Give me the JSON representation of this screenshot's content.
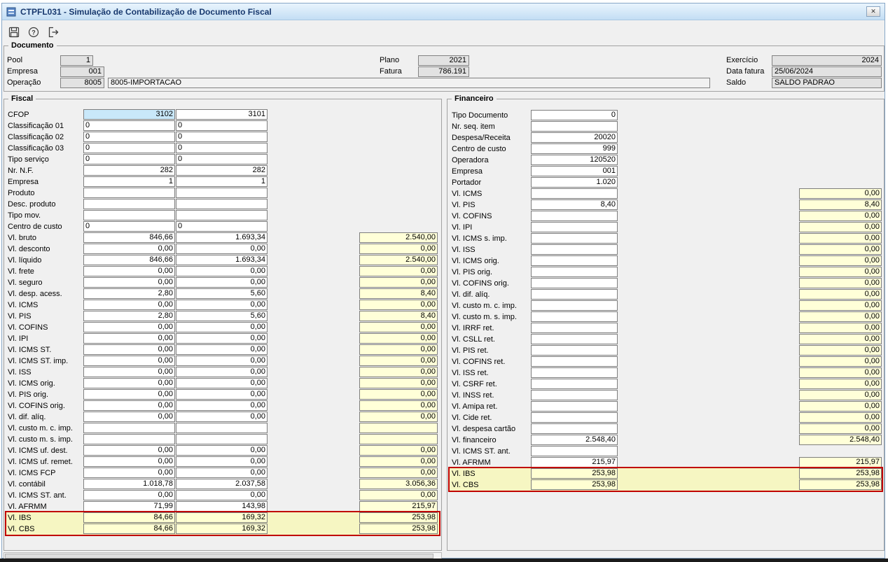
{
  "window": {
    "title": "CTPFL031 - Simulação de Contabilização de Documento Fiscal",
    "close_glyph": "✕"
  },
  "toolbar": {
    "buttons": [
      {
        "name": "save"
      },
      {
        "name": "help"
      },
      {
        "name": "exit"
      }
    ]
  },
  "documento": {
    "title": "Documento",
    "pool": {
      "label": "Pool",
      "value": "1"
    },
    "empresa": {
      "label": "Empresa",
      "value": "001"
    },
    "operacao": {
      "label": "Operação",
      "value": "8005",
      "descricao": "8005-IMPORTACAO"
    },
    "plano": {
      "label": "Plano",
      "value": "2021"
    },
    "fatura": {
      "label": "Fatura",
      "value": "786.191"
    },
    "exercicio": {
      "label": "Exercício",
      "value": "2024"
    },
    "data_fatura": {
      "label": "Data fatura",
      "value": "25/06/2024"
    },
    "saldo": {
      "label": "Saldo",
      "value": "SALDO PADRAO"
    }
  },
  "fiscal": {
    "title": "Fiscal",
    "rows": [
      {
        "label": "CFOP",
        "c1": "3102",
        "c2": "3101",
        "total": null,
        "focus": "c1"
      },
      {
        "label": "Classificação 01",
        "c1": "0",
        "c2": "0",
        "total": null,
        "align": "left"
      },
      {
        "label": "Classificação 02",
        "c1": "0",
        "c2": "0",
        "total": null,
        "align": "left"
      },
      {
        "label": "Classificação 03",
        "c1": "0",
        "c2": "0",
        "total": null,
        "align": "left"
      },
      {
        "label": "Tipo serviço",
        "c1": "0",
        "c2": "0",
        "total": null,
        "align": "left"
      },
      {
        "label": "Nr. N.F.",
        "c1": "282",
        "c2": "282",
        "total": null
      },
      {
        "label": "Empresa",
        "c1": "1",
        "c2": "1",
        "total": null
      },
      {
        "label": "Produto",
        "c1": "",
        "c2": "",
        "total": null
      },
      {
        "label": "Desc. produto",
        "c1": "",
        "c2": "",
        "total": null
      },
      {
        "label": "Tipo mov.",
        "c1": "",
        "c2": "",
        "total": null
      },
      {
        "label": "Centro de custo",
        "c1": "0",
        "c2": "0",
        "total": null,
        "align": "left"
      },
      {
        "label": "Vl. bruto",
        "c1": "846,66",
        "c2": "1.693,34",
        "total": "2.540,00"
      },
      {
        "label": "Vl. desconto",
        "c1": "0,00",
        "c2": "0,00",
        "total": "0,00"
      },
      {
        "label": "Vl. líquido",
        "c1": "846,66",
        "c2": "1.693,34",
        "total": "2.540,00"
      },
      {
        "label": "Vl. frete",
        "c1": "0,00",
        "c2": "0,00",
        "total": "0,00"
      },
      {
        "label": "Vl. seguro",
        "c1": "0,00",
        "c2": "0,00",
        "total": "0,00"
      },
      {
        "label": "Vl. desp. acess.",
        "c1": "2,80",
        "c2": "5,60",
        "total": "8,40"
      },
      {
        "label": "Vl. ICMS",
        "c1": "0,00",
        "c2": "0,00",
        "total": "0,00"
      },
      {
        "label": "Vl. PIS",
        "c1": "2,80",
        "c2": "5,60",
        "total": "8,40"
      },
      {
        "label": "Vl. COFINS",
        "c1": "0,00",
        "c2": "0,00",
        "total": "0,00"
      },
      {
        "label": "Vl. IPI",
        "c1": "0,00",
        "c2": "0,00",
        "total": "0,00"
      },
      {
        "label": "Vl. ICMS ST.",
        "c1": "0,00",
        "c2": "0,00",
        "total": "0,00"
      },
      {
        "label": "Vl. ICMS ST. imp.",
        "c1": "0,00",
        "c2": "0,00",
        "total": "0,00"
      },
      {
        "label": "Vl. ISS",
        "c1": "0,00",
        "c2": "0,00",
        "total": "0,00"
      },
      {
        "label": "Vl. ICMS orig.",
        "c1": "0,00",
        "c2": "0,00",
        "total": "0,00"
      },
      {
        "label": "Vl. PIS orig.",
        "c1": "0,00",
        "c2": "0,00",
        "total": "0,00"
      },
      {
        "label": "Vl. COFINS orig.",
        "c1": "0,00",
        "c2": "0,00",
        "total": "0,00"
      },
      {
        "label": "Vl. dif. alíq.",
        "c1": "0,00",
        "c2": "0,00",
        "total": "0,00"
      },
      {
        "label": "Vl. custo m. c. imp.",
        "c1": "",
        "c2": "",
        "total": ""
      },
      {
        "label": "Vl. custo m. s. imp.",
        "c1": "",
        "c2": "",
        "total": ""
      },
      {
        "label": "Vl. ICMS uf. dest.",
        "c1": "0,00",
        "c2": "0,00",
        "total": "0,00"
      },
      {
        "label": "Vl. ICMS uf. remet.",
        "c1": "0,00",
        "c2": "0,00",
        "total": "0,00"
      },
      {
        "label": "Vl. ICMS FCP",
        "c1": "0,00",
        "c2": "0,00",
        "total": "0,00"
      },
      {
        "label": "Vl. contábil",
        "c1": "1.018,78",
        "c2": "2.037,58",
        "total": "3.056,36"
      },
      {
        "label": "Vl. ICMS ST. ant.",
        "c1": "0,00",
        "c2": "0,00",
        "total": "0,00"
      },
      {
        "label": "Vl. AFRMM",
        "c1": "71,99",
        "c2": "143,98",
        "total": "215,97"
      },
      {
        "label": "Vl. IBS",
        "c1": "84,66",
        "c2": "169,32",
        "total": "253,98",
        "highlight": true
      },
      {
        "label": "Vl. CBS",
        "c1": "84,66",
        "c2": "169,32",
        "total": "253,98",
        "highlight": true
      }
    ]
  },
  "financeiro": {
    "title": "Financeiro",
    "rows": [
      {
        "label": "Tipo Documento",
        "value": "0",
        "total": null
      },
      {
        "label": "Nr. seq. item",
        "value": "",
        "total": null
      },
      {
        "label": "Despesa/Receita",
        "value": "20020",
        "total": null
      },
      {
        "label": "Centro de custo",
        "value": "999",
        "total": null
      },
      {
        "label": "Operadora",
        "value": "120520",
        "total": null
      },
      {
        "label": "Empresa",
        "value": "001",
        "total": null
      },
      {
        "label": "Portador",
        "value": "1.020",
        "total": null
      },
      {
        "label": "Vl. ICMS",
        "value": "",
        "total": "0,00"
      },
      {
        "label": "Vl. PIS",
        "value": "8,40",
        "total": "8,40"
      },
      {
        "label": "Vl. COFINS",
        "value": "",
        "total": "0,00"
      },
      {
        "label": "Vl. IPI",
        "value": "",
        "total": "0,00"
      },
      {
        "label": "Vl. ICMS s. imp.",
        "value": "",
        "total": "0,00"
      },
      {
        "label": "Vl. ISS",
        "value": "",
        "total": "0,00"
      },
      {
        "label": "Vl. ICMS orig.",
        "value": "",
        "total": "0,00"
      },
      {
        "label": "Vl. PIS orig.",
        "value": "",
        "total": "0,00"
      },
      {
        "label": "Vl. COFINS orig.",
        "value": "",
        "total": "0,00"
      },
      {
        "label": "Vl. dif. alíq.",
        "value": "",
        "total": "0,00"
      },
      {
        "label": "Vl. custo m. c. imp.",
        "value": "",
        "total": "0,00"
      },
      {
        "label": "Vl. custo m. s. imp.",
        "value": "",
        "total": "0,00"
      },
      {
        "label": "Vl. IRRF ret.",
        "value": "",
        "total": "0,00"
      },
      {
        "label": "Vl. CSLL ret.",
        "value": "",
        "total": "0,00"
      },
      {
        "label": "Vl. PIS ret.",
        "value": "",
        "total": "0,00"
      },
      {
        "label": "Vl. COFINS ret.",
        "value": "",
        "total": "0,00"
      },
      {
        "label": "Vl. ISS ret.",
        "value": "",
        "total": "0,00"
      },
      {
        "label": "Vl. CSRF ret.",
        "value": "",
        "total": "0,00"
      },
      {
        "label": "Vl. INSS ret.",
        "value": "",
        "total": "0,00"
      },
      {
        "label": "Vl. Amipa ret.",
        "value": "",
        "total": "0,00"
      },
      {
        "label": "Vl. Cide ret.",
        "value": "",
        "total": "0,00"
      },
      {
        "label": "Vl. despesa cartão",
        "value": "",
        "total": "0,00"
      },
      {
        "label": "Vl. financeiro",
        "value": "2.548,40",
        "total": "2.548,40"
      },
      {
        "label": "Vl. ICMS ST. ant.",
        "value": "",
        "total": null
      },
      {
        "label": "Vl. AFRMM",
        "value": "215,97",
        "total": "215,97"
      },
      {
        "label": "Vl. IBS",
        "value": "253,98",
        "total": "253,98",
        "highlight": true
      },
      {
        "label": "Vl. CBS",
        "value": "253,98",
        "total": "253,98",
        "highlight": true
      }
    ]
  },
  "colors": {
    "titlebar_top": "#e9f4fd",
    "titlebar_bottom": "#c3def4",
    "title_text": "#17386e",
    "dialog_bg": "#f0f0f0",
    "field_border": "#7e7e7e",
    "disabled_field_bg": "#e2e2e2",
    "total_field_bg": "#ffffd8",
    "highlight_row_bg": "#f6f6c2",
    "focus_field_bg": "#c9e8fa",
    "highlight_border": "#c00000"
  }
}
